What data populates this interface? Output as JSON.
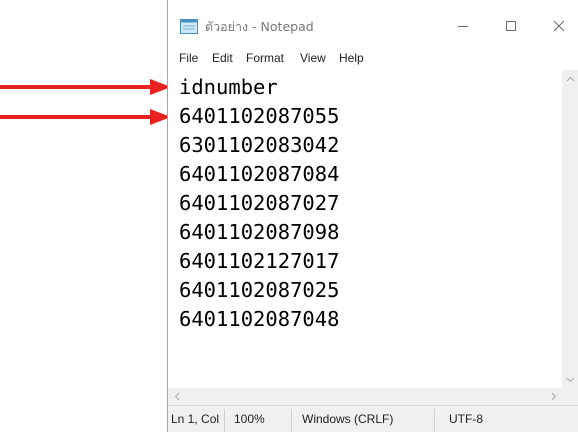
{
  "window": {
    "title": "ตัวอย่าง - Notepad",
    "app_icon": "notepad-icon",
    "controls": [
      "minimize-icon",
      "maximize-icon",
      "close-icon"
    ]
  },
  "menu": {
    "items": [
      "File",
      "Edit",
      "Format",
      "View",
      "Help"
    ]
  },
  "editor": {
    "lines": [
      "idnumber",
      "6401102087055",
      "6301102083042",
      "6401102087084",
      "6401102087027",
      "6401102087098",
      "6401102127017",
      "6401102087025",
      "6401102087048"
    ]
  },
  "statusbar": {
    "position": "Ln 1, Col 1",
    "zoom": "100%",
    "line_ending": "Windows (CRLF)",
    "encoding": "UTF-8"
  },
  "annotations": {
    "arrow_color": "#e8231f",
    "arrow_targets": [
      "line-1",
      "line-2"
    ]
  }
}
